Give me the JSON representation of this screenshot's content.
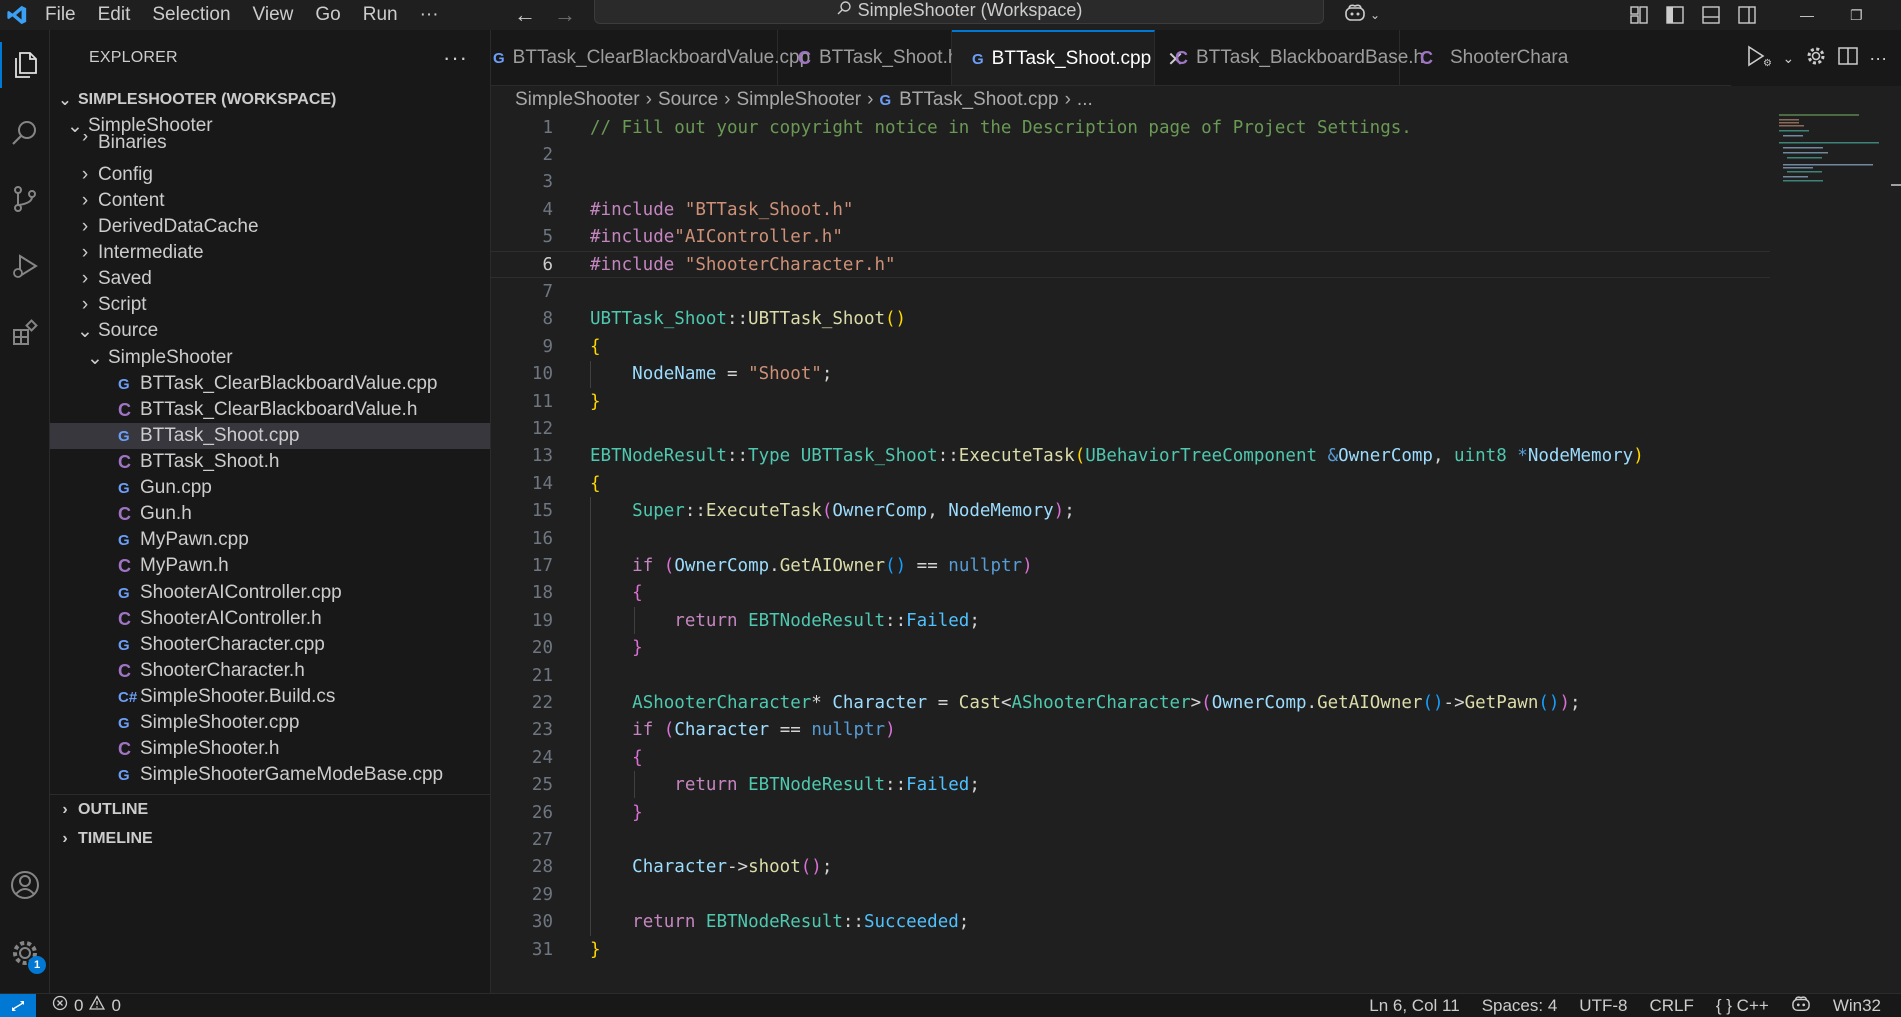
{
  "menu": [
    "File",
    "Edit",
    "Selection",
    "View",
    "Go",
    "Run",
    "···"
  ],
  "command_center": "SimpleShooter (Workspace)",
  "explorer": {
    "title": "EXPLORER",
    "more": "···",
    "workspace": "SIMPLESHOOTER (WORKSPACE)",
    "root_folder": "SimpleShooter",
    "partial_item": "Binaries",
    "folders": [
      "Config",
      "Content",
      "DerivedDataCache",
      "Intermediate",
      "Saved",
      "Script"
    ],
    "source_folder": "Source",
    "sub_folder": "SimpleShooter",
    "files": [
      {
        "name": "BTTask_ClearBlackboardValue.cpp",
        "kind": "cpp"
      },
      {
        "name": "BTTask_ClearBlackboardValue.h",
        "kind": "h"
      },
      {
        "name": "BTTask_Shoot.cpp",
        "kind": "cpp"
      },
      {
        "name": "BTTask_Shoot.h",
        "kind": "h"
      },
      {
        "name": "Gun.cpp",
        "kind": "cpp"
      },
      {
        "name": "Gun.h",
        "kind": "h"
      },
      {
        "name": "MyPawn.cpp",
        "kind": "cpp"
      },
      {
        "name": "MyPawn.h",
        "kind": "h"
      },
      {
        "name": "ShooterAIController.cpp",
        "kind": "cpp"
      },
      {
        "name": "ShooterAIController.h",
        "kind": "h"
      },
      {
        "name": "ShooterCharacter.cpp",
        "kind": "cpp"
      },
      {
        "name": "ShooterCharacter.h",
        "kind": "h"
      },
      {
        "name": "SimpleShooter.Build.cs",
        "kind": "cs"
      },
      {
        "name": "SimpleShooter.cpp",
        "kind": "cpp"
      },
      {
        "name": "SimpleShooter.h",
        "kind": "h"
      },
      {
        "name": "SimpleShooterGameModeBase.cpp",
        "kind": "cpp"
      }
    ],
    "selected_file": "BTTask_Shoot.cpp",
    "outline": "OUTLINE",
    "timeline": "TIMELINE"
  },
  "tabs": [
    {
      "label": "BTTask_ClearBlackboardValue.cpp",
      "kind": "cpp",
      "active": false
    },
    {
      "label": "BTTask_Shoot.h",
      "kind": "h",
      "active": false
    },
    {
      "label": "BTTask_Shoot.cpp",
      "kind": "cpp",
      "active": true
    },
    {
      "label": "BTTask_BlackboardBase.h",
      "kind": "h",
      "active": false
    },
    {
      "label": "ShooterChara",
      "kind": "h",
      "active": false
    }
  ],
  "breadcrumb": [
    "SimpleShooter",
    "Source",
    "SimpleShooter",
    "BTTask_Shoot.cpp",
    "..."
  ],
  "editor": {
    "current_line": 6,
    "line_numbers": [
      "1",
      "2",
      "3",
      "4",
      "5",
      "6",
      "7",
      "8",
      "9",
      "10",
      "11",
      "12",
      "13",
      "14",
      "15",
      "16",
      "17",
      "18",
      "19",
      "20",
      "21",
      "22",
      "23",
      "24",
      "25",
      "26",
      "27",
      "28",
      "29",
      "30",
      "31"
    ]
  },
  "status": {
    "errors": "0",
    "warnings": "0",
    "position": "Ln 6, Col 11",
    "spaces": "Spaces: 4",
    "encoding": "UTF-8",
    "eol": "CRLF",
    "language": "{ } C++",
    "platform": "Win32"
  },
  "accounts_badge": "1",
  "colors": {
    "accent": "#0078d4",
    "editor_bg": "#1f1f1f",
    "sidebar_bg": "#181818"
  }
}
